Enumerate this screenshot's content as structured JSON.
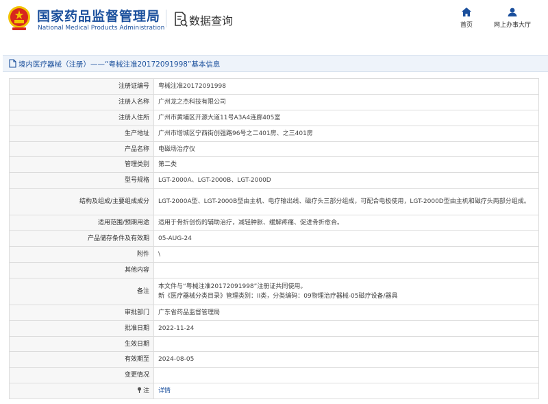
{
  "header": {
    "brand_cn": "国家药品监督管理局",
    "brand_en": "National Medical Products Administration",
    "query_title": "数据查询",
    "nav": [
      {
        "label": "首页",
        "icon": "home-icon"
      },
      {
        "label": "网上办事大厅",
        "icon": "user-icon"
      }
    ]
  },
  "title_bar": {
    "text": "境内医疗器械（注册）——“粤械注准20172091998”基本信息",
    "icon": "document-icon"
  },
  "rows": [
    {
      "label": "注册证编号",
      "value": "粤械注准20172091998"
    },
    {
      "label": "注册人名称",
      "value": "广州龙之杰科技有限公司"
    },
    {
      "label": "注册人住所",
      "value": "广州市黄埔区开源大道11号A3A4连廊405室"
    },
    {
      "label": "生产地址",
      "value": "广州市增城区宁西街创强路96号之二401房、之三401房"
    },
    {
      "label": "产品名称",
      "value": "电磁场治疗仪"
    },
    {
      "label": "管理类别",
      "value": "第二类"
    },
    {
      "label": "型号规格",
      "value": "LGT-2000A、LGT-2000B、LGT-2000D"
    },
    {
      "label": "结构及组成/主要组成成分",
      "value": "LGT-2000A型、LGT-2000B型由主机、电疗输出线、磁疗头三部分组成，可配合电极使用，LGT-2000D型由主机和磁疗头两部分组成。"
    },
    {
      "label": "适用范围/预期用途",
      "value": "适用于骨折创伤的辅助治疗，减轻肿胀、缓解疼痛、促进骨折愈合。"
    },
    {
      "label": "产品储存条件及有效期",
      "value": "05-AUG-24"
    },
    {
      "label": "附件",
      "value": "\\"
    },
    {
      "label": "其他内容",
      "value": ""
    },
    {
      "label": "备注",
      "value_line1": "本文件与“粤械注准20172091998”注册证共同使用。",
      "value_line2": "新《医疗器械分类目录》管理类别：II类，分类编码：09物理治疗器械-05磁疗设备/器具"
    },
    {
      "label": "审批部门",
      "value": "广东省药品监督管理局"
    },
    {
      "label": "批准日期",
      "value": "2022-11-24"
    },
    {
      "label": "生效日期",
      "value": ""
    },
    {
      "label": "有效期至",
      "value": "2024-08-05"
    },
    {
      "label": "变更情况",
      "value": ""
    },
    {
      "label": "注",
      "icon": "pin-icon",
      "value": "详情"
    }
  ],
  "colors": {
    "brand_blue": "#1a4f9c",
    "emblem_red": "#d7261e",
    "emblem_gold": "#f2c200",
    "title_bar_bg": "#eef3fa"
  }
}
